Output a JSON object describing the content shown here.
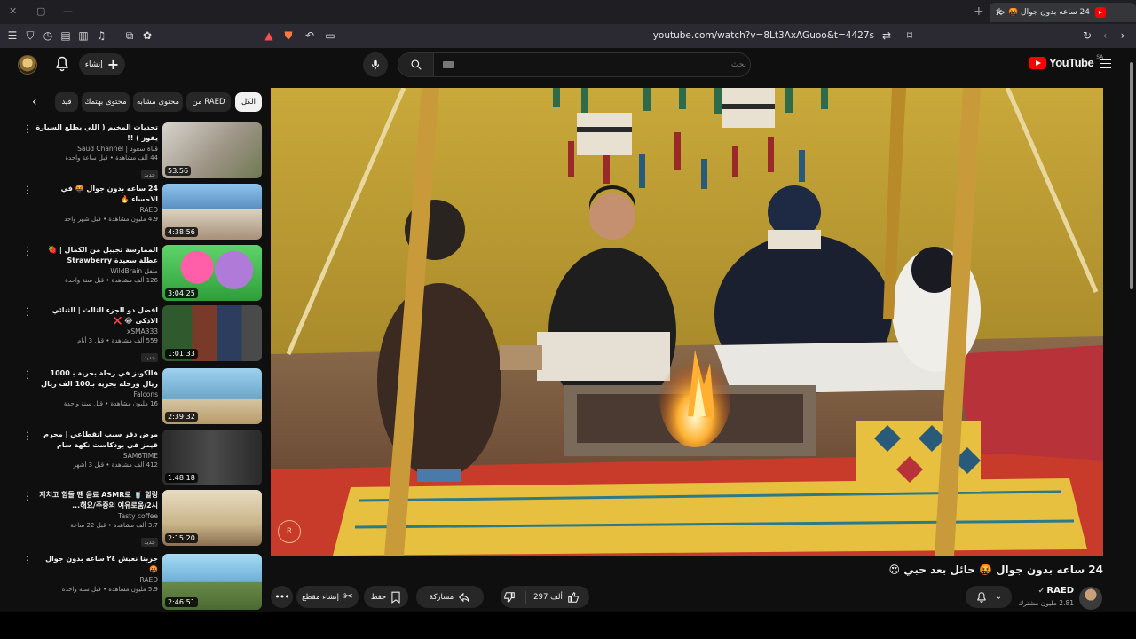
{
  "browser": {
    "tab_title": "24 ساعه بدون جوال 🤬 حائل بعد حبي",
    "url": "youtube.com/watch?v=8Lt3AxAGuoo&t=4427s"
  },
  "header": {
    "create_label": "إنشاء",
    "search_placeholder": "بحث",
    "logo_text": "YouTube",
    "logo_region": "SA"
  },
  "chips": [
    "الكل",
    "من RAED",
    "محتوى مشابه",
    "محتوى بهتمك",
    "قيد"
  ],
  "recommendations": [
    {
      "title": "تحديات المخيم ( اللي يطلع السيارة يفوز ) !!",
      "channel": "قناة سعود | Saud Channel",
      "meta": "44 ألف مشاهدة • قبل ساعة واحدة",
      "badge": "جديد",
      "duration": "53:56"
    },
    {
      "title": "24 ساعه بدون جوال 🤬 في الاحساء 🔥",
      "channel": "RAED",
      "meta": "4.9 مليون مشاهدة • قبل شهر واحد",
      "badge": "",
      "duration": "4:38:56"
    },
    {
      "title": "الممارسة تجيبل من الكمال | 🍓 عطلة سعيدة Strawberry Shortcake | 🍓 عر...",
      "channel": "طفل WildBrain",
      "meta": "126 ألف مشاهدة • قبل سنة واحدة",
      "badge": "",
      "duration": "3:04:25"
    },
    {
      "title": "افضل دو الجزء الثالث | الثنائي الاذكى 😂 ❌",
      "channel": "xSMA333",
      "meta": "559 ألف مشاهدة • قبل 3 أيام",
      "badge": "جديد",
      "duration": "1:01:33"
    },
    {
      "title": "فالكونز في رحلة بحرية بـ1000 ريال ورحلة بحرية بـ100 الف ريال 🔥 🛥️",
      "channel": "Falcons",
      "meta": "16 مليون مشاهدة • قبل سنة واحدة",
      "badge": "",
      "duration": "2:39:32"
    },
    {
      "title": "مرض دقر سبب انقطاعي | مجرم قيمز في بودكاست نكهة سام",
      "channel": "SAM6TIME",
      "meta": "412 ألف مشاهدة • قبل 3 أشهر",
      "badge": "",
      "duration": "1:48:18"
    },
    {
      "title": "지치고 힘들 땐 음료 ASMR로 🥤 힐링해요/주중의 여유로움/2시...",
      "channel": "Tasty coffee",
      "meta": "3.7 ألف مشاهدة • قبل 22 ساعة",
      "badge": "جديد",
      "duration": "2:15:20"
    },
    {
      "title": "جربنا نعيش ٢٤ ساعه بدون جوال 🤬",
      "channel": "RAED",
      "meta": "5.9 مليون مشاهدة • قبل سنة واحدة",
      "badge": "",
      "duration": "2:46:51"
    }
  ],
  "video": {
    "title": "24 ساعه بدون جوال 🤬 حائل بعد حبي 😍",
    "channel": "RAED",
    "subscribers": "2.81 مليون مشترك",
    "likes": "297 ألف",
    "share_label": "مشاركة",
    "save_label": "حفظ",
    "clip_label": "إنشاء مقطع"
  },
  "thumb_colors": [
    "#b9b3a6",
    "#5a8fc0",
    "#e04ea0",
    "#3d6a3a",
    "#7aa6c8",
    "#3a3a3a",
    "#c9b58a",
    "#6fb0d8"
  ]
}
